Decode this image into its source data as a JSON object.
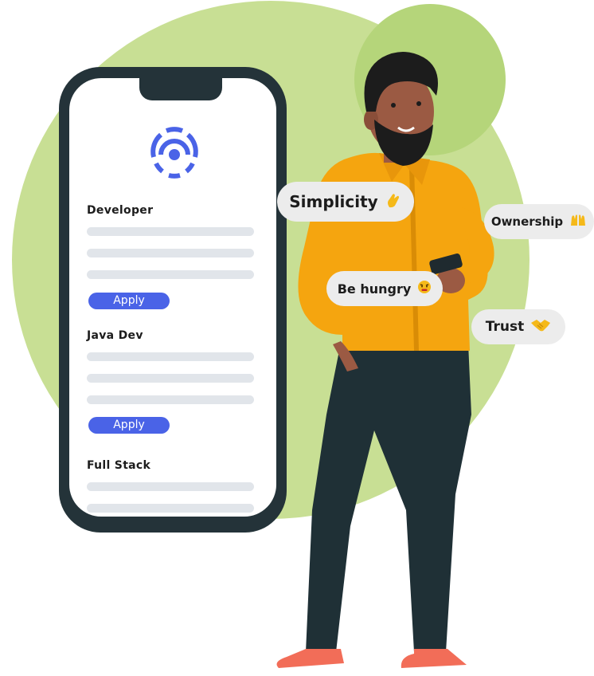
{
  "phone": {
    "logo_icon": "target-logo-icon",
    "jobs": [
      {
        "title": "Developer",
        "apply_label": "Apply"
      },
      {
        "title": "Java Dev",
        "apply_label": "Apply"
      },
      {
        "title": "Full Stack"
      }
    ]
  },
  "values": {
    "simplicity": {
      "label": "Simplicity",
      "icon": "crossed-fingers-icon"
    },
    "ownership": {
      "label": "Ownership",
      "icon": "raising-hands-icon"
    },
    "be_hungry": {
      "label": "Be hungry",
      "icon": "angry-face-icon"
    },
    "trust": {
      "label": "Trust",
      "icon": "handshake-icon"
    }
  },
  "colors": {
    "accent_blue": "#4a63e7",
    "background_green": "#c8df94",
    "phone_frame": "#243339",
    "shirt": "#f5a50f",
    "skin": "#9b5a43",
    "pants": "#1f3036",
    "shoes": "#f26d58",
    "bubble_bg": "#ececec"
  }
}
